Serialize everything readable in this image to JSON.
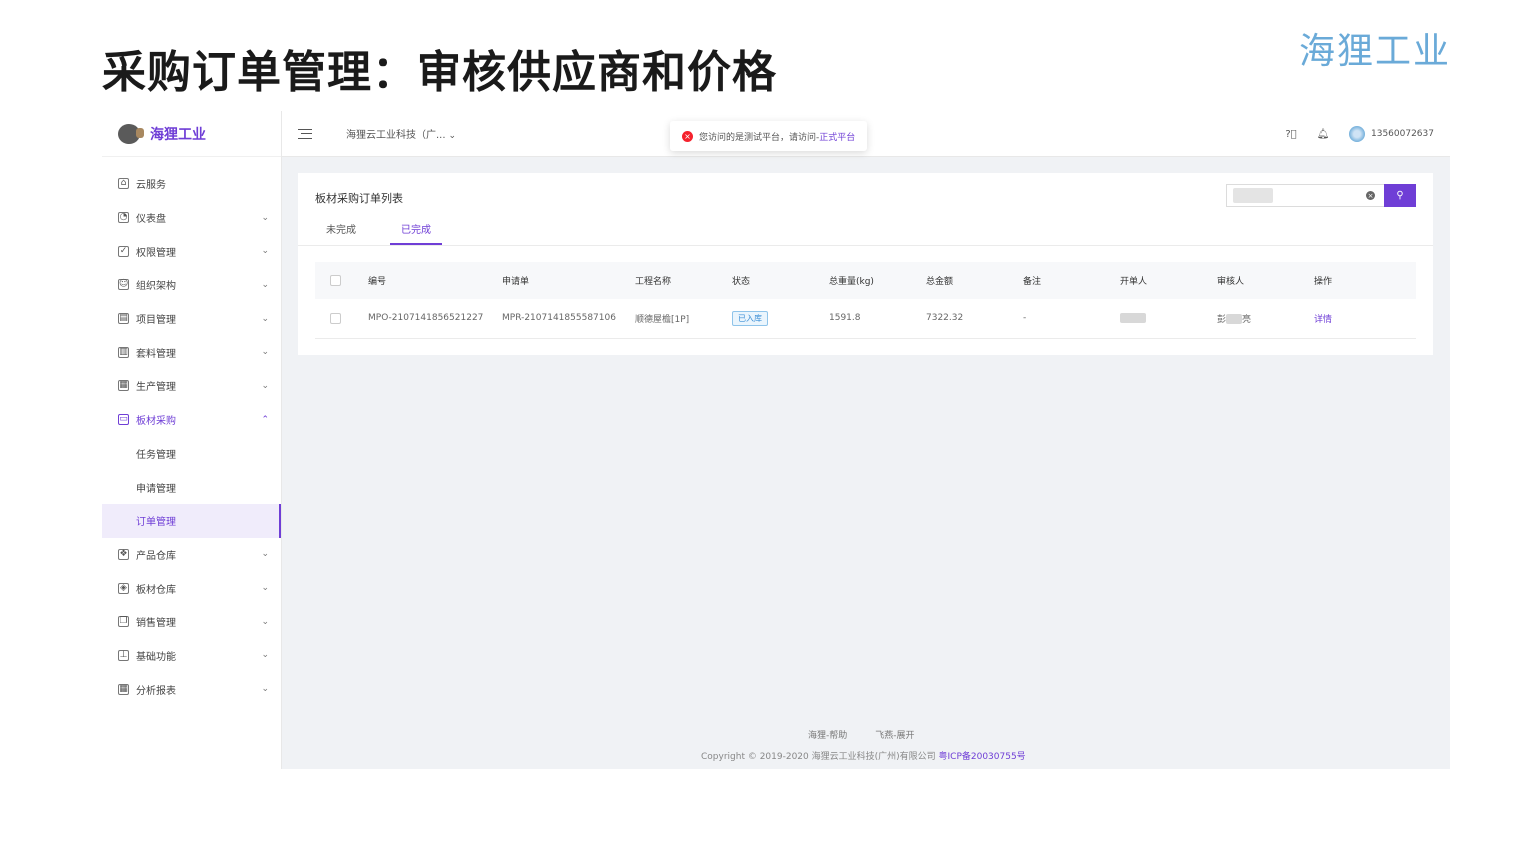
{
  "slide": {
    "title": "采购订单管理：审核供应商和价格",
    "brand": "海狸工业"
  },
  "sidebar": {
    "logo_text": "海狸工业",
    "items": [
      {
        "label": "云服务",
        "icon": "home-icon"
      },
      {
        "label": "仪表盘",
        "icon": "dashboard-icon"
      },
      {
        "label": "权限管理",
        "icon": "shield-icon"
      },
      {
        "label": "组织架构",
        "icon": "people-icon"
      },
      {
        "label": "项目管理",
        "icon": "project-icon"
      },
      {
        "label": "套料管理",
        "icon": "layers-icon"
      },
      {
        "label": "生产管理",
        "icon": "factory-icon"
      },
      {
        "label": "板材采购",
        "icon": "lock-icon"
      },
      {
        "label": "任务管理"
      },
      {
        "label": "申请管理"
      },
      {
        "label": "订单管理"
      },
      {
        "label": "产品仓库",
        "icon": "dropbox-icon"
      },
      {
        "label": "板材仓库",
        "icon": "cube-icon"
      },
      {
        "label": "销售管理",
        "icon": "copy-icon"
      },
      {
        "label": "基础功能",
        "icon": "tree-icon"
      },
      {
        "label": "分析报表",
        "icon": "grid-icon"
      }
    ]
  },
  "topbar": {
    "company": "海狸云工业科技（广...",
    "notice_text": "您访问的是测试平台，请访问-",
    "notice_link": "正式平台",
    "user_phone": "13560072637"
  },
  "card": {
    "title": "板材采购订单列表",
    "tabs": [
      "未完成",
      "已完成"
    ]
  },
  "table": {
    "columns": [
      "编号",
      "申请单",
      "工程名称",
      "状态",
      "总重量(kg)",
      "总金额",
      "备注",
      "开单人",
      "审核人",
      "操作"
    ],
    "rows": [
      {
        "code": "MPO-2107141856521227",
        "request": "MPR-2107141855587106",
        "project": "顺德屋檐[1P]",
        "status": "已入库",
        "weight": "1591.8",
        "amount": "7322.32",
        "remark": "-",
        "reviewer_partial": "彭",
        "reviewer_suffix": "亮",
        "action": "详情"
      }
    ]
  },
  "footer": {
    "link1": "海狸-帮助",
    "link2": "飞燕-展开",
    "copyright": "Copyright © 2019-2020 海狸云工业科技(广州)有限公司 ",
    "icp": "粤ICP备20030755号"
  },
  "colors": {
    "accent": "#6f3ed6",
    "error": "#f5222d",
    "status_tag": "#3c8fd6"
  }
}
